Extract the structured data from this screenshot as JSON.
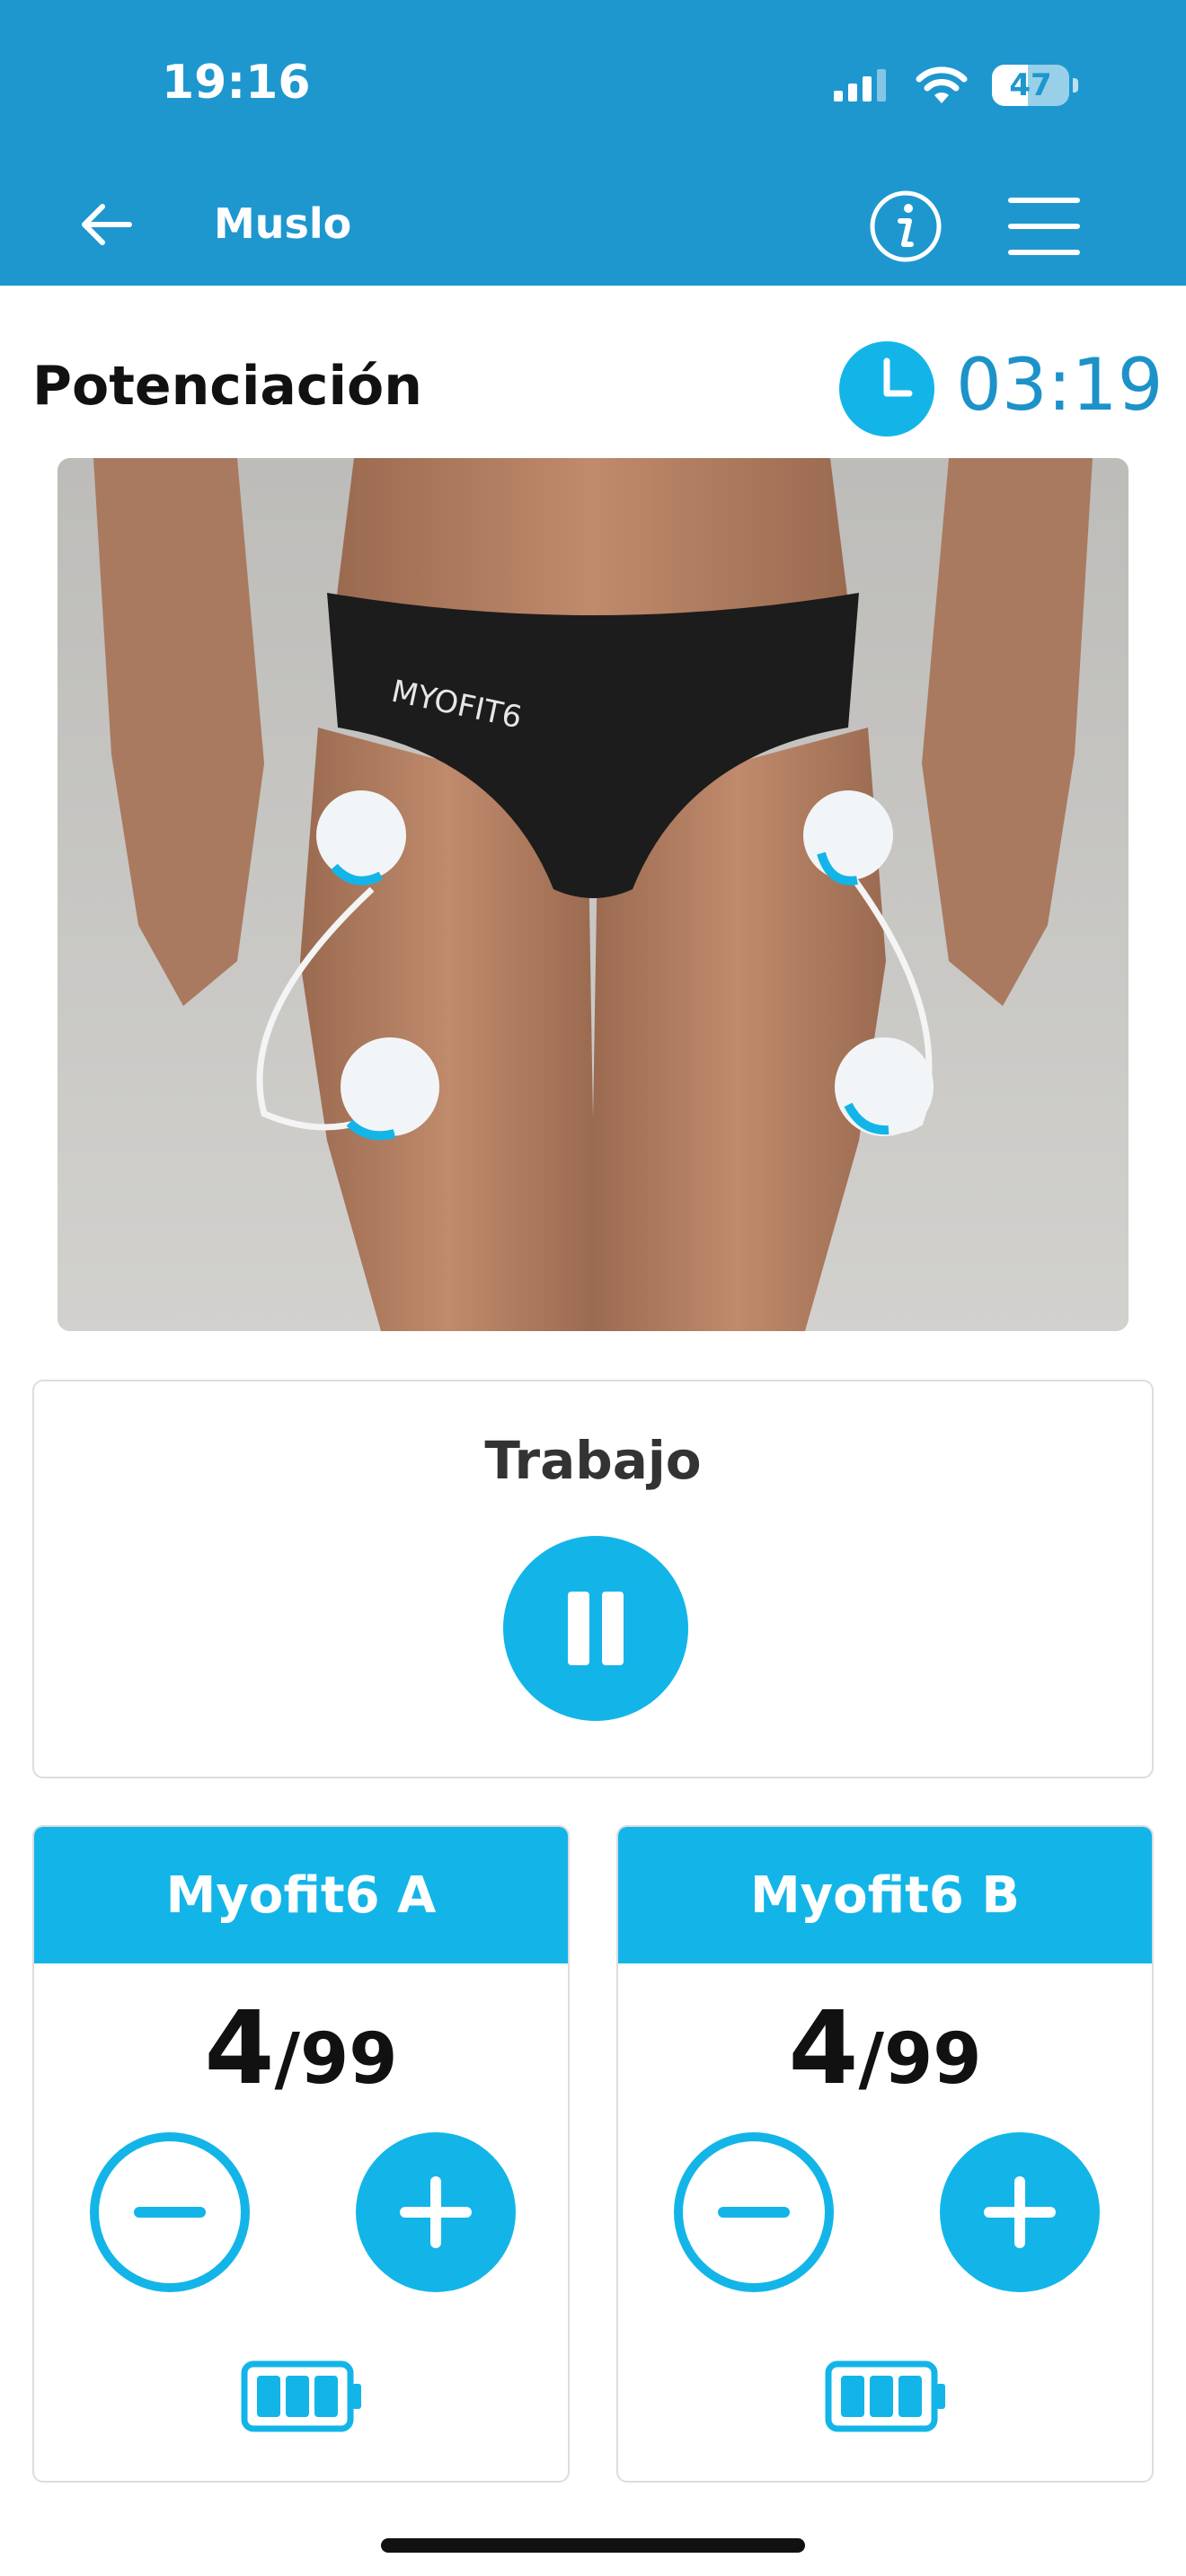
{
  "status_bar": {
    "time": "19:16",
    "battery_level": "47",
    "icons": [
      "cellular-signal-icon",
      "wifi-icon",
      "battery-icon"
    ]
  },
  "header": {
    "title": "Muslo",
    "icons": [
      "back-arrow-icon",
      "info-icon",
      "menu-icon"
    ]
  },
  "session": {
    "program_name": "Potenciación",
    "timer": "03:19",
    "phase_label": "Trabajo"
  },
  "devices": [
    {
      "name": "Myofit6 A",
      "intensity": "4",
      "slash": "/",
      "max": "99",
      "battery_bars": 3
    },
    {
      "name": "Myofit6 B",
      "intensity": "4",
      "slash": "/",
      "max": "99",
      "battery_bars": 3
    }
  ],
  "colors": {
    "header_blue": "#1e97cf",
    "accent_cyan": "#13b5e8",
    "timer_blue": "#1d92c9"
  }
}
